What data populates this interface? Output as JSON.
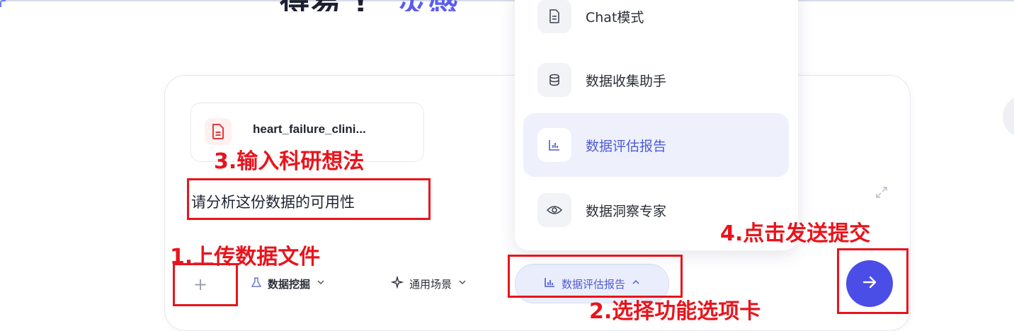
{
  "heading": {
    "left_text": "得易 !",
    "right_text": "灵感"
  },
  "file": {
    "name": "heart_failure_clini...",
    "icon": "document-icon"
  },
  "input": {
    "value": "请分析这份数据的可用性"
  },
  "toolbar": {
    "plus_label": "+",
    "mining_label": "数据挖掘",
    "scene_label": "通用场景",
    "active_mode_label": "数据评估报告"
  },
  "dropdown": {
    "items": [
      {
        "label": "Chat模式",
        "icon": "document-icon",
        "selected": false
      },
      {
        "label": "数据收集助手",
        "icon": "database-icon",
        "selected": false
      },
      {
        "label": "数据评估报告",
        "icon": "bar-chart-icon",
        "selected": true
      },
      {
        "label": "数据洞察专家",
        "icon": "eye-icon",
        "selected": false
      }
    ]
  },
  "annotations": {
    "step1": "1.上传数据文件",
    "step2": "2.选择功能选项卡",
    "step3": "3.输入科研想法",
    "step4": "4.点击发送提交"
  },
  "colors": {
    "accent": "#4a4de6",
    "annotation_red": "#e8141c",
    "selected_bg": "#eef0fc"
  }
}
